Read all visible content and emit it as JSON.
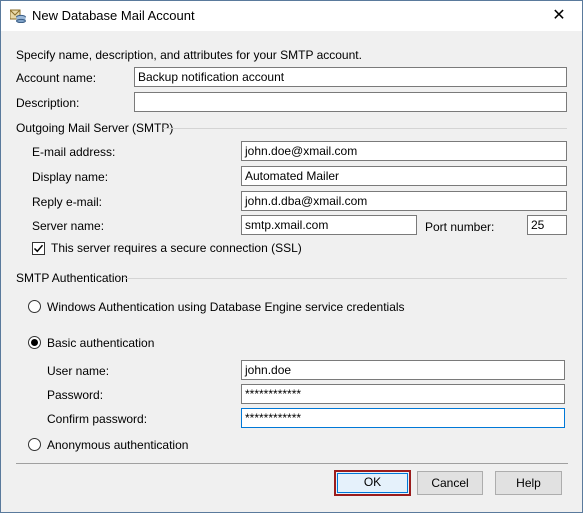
{
  "window": {
    "title": "New Database Mail Account",
    "close_glyph": "✕"
  },
  "intro": "Specify name, description, and attributes for your SMTP account.",
  "account": {
    "name_label": "Account name:",
    "name_value": "Backup notification account",
    "description_label": "Description:",
    "description_value": ""
  },
  "smtp": {
    "group_label": "Outgoing Mail Server (SMTP)",
    "email_label": "E-mail address:",
    "email_value": "john.doe@xmail.com",
    "display_label": "Display name:",
    "display_value": "Automated Mailer",
    "reply_label": "Reply e-mail:",
    "reply_value": "john.d.dba@xmail.com",
    "server_label": "Server name:",
    "server_value": "smtp.xmail.com",
    "port_label": "Port number:",
    "port_value": "25",
    "ssl_label": "This server requires a secure connection (SSL)",
    "ssl_checked": true
  },
  "auth": {
    "group_label": "SMTP Authentication",
    "windows_label": "Windows Authentication using Database Engine service credentials",
    "basic_label": "Basic authentication",
    "user_label": "User name:",
    "user_value": "john.doe",
    "password_label": "Password:",
    "password_value": "************",
    "confirm_label": "Confirm password:",
    "confirm_value": "************",
    "anonymous_label": "Anonymous authentication",
    "selected": "basic"
  },
  "buttons": {
    "ok": "OK",
    "cancel": "Cancel",
    "help": "Help"
  }
}
